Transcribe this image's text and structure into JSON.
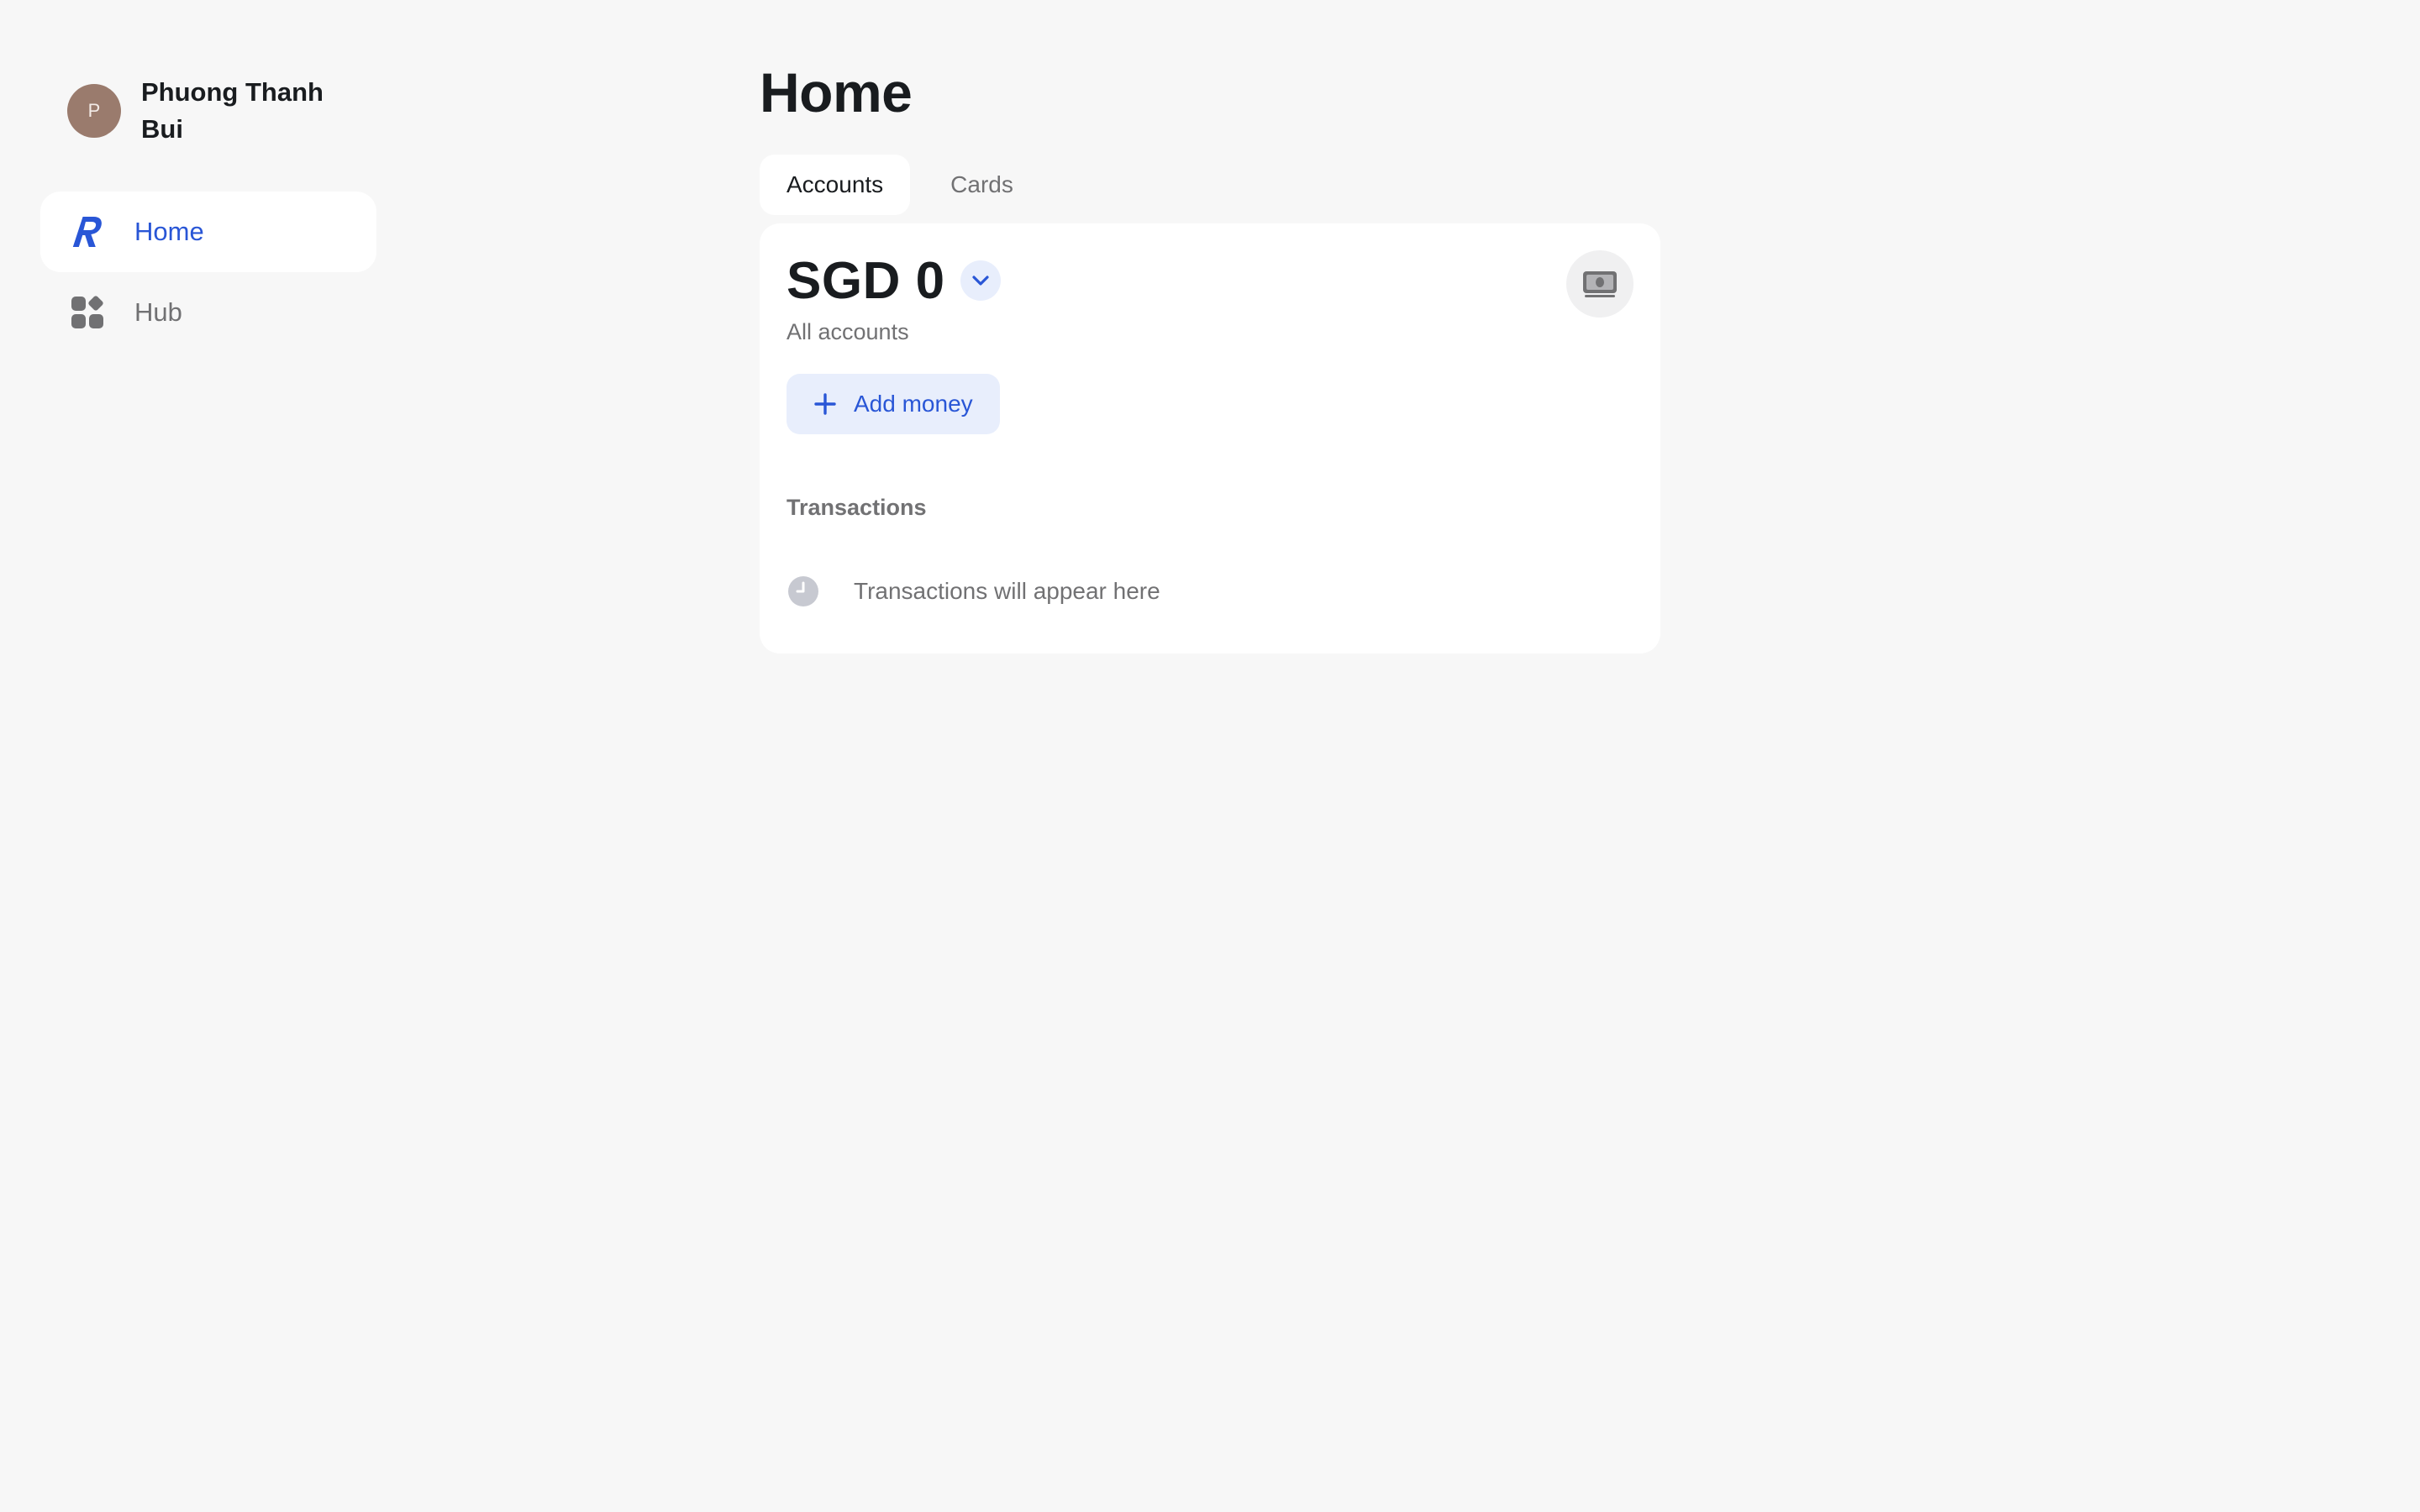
{
  "profile": {
    "avatar_initial": "P",
    "name": "Phuong Thanh Bui"
  },
  "sidebar": {
    "items": [
      {
        "label": "Home",
        "icon": "revolut-logo-icon",
        "active": true
      },
      {
        "label": "Hub",
        "icon": "grid-icon",
        "active": false
      }
    ]
  },
  "main": {
    "title": "Home",
    "tabs": [
      {
        "label": "Accounts",
        "active": true
      },
      {
        "label": "Cards",
        "active": false
      }
    ],
    "balance": {
      "amount": "SGD 0",
      "caption": "All accounts"
    },
    "add_money_label": "Add money",
    "transactions": {
      "title": "Transactions",
      "empty_text": "Transactions will appear here"
    }
  },
  "colors": {
    "background": "#f7f7f7",
    "accent": "#2956d6",
    "accent_soft": "#e8eefc",
    "muted_text": "#717173",
    "avatar": "#9a7b6d"
  }
}
